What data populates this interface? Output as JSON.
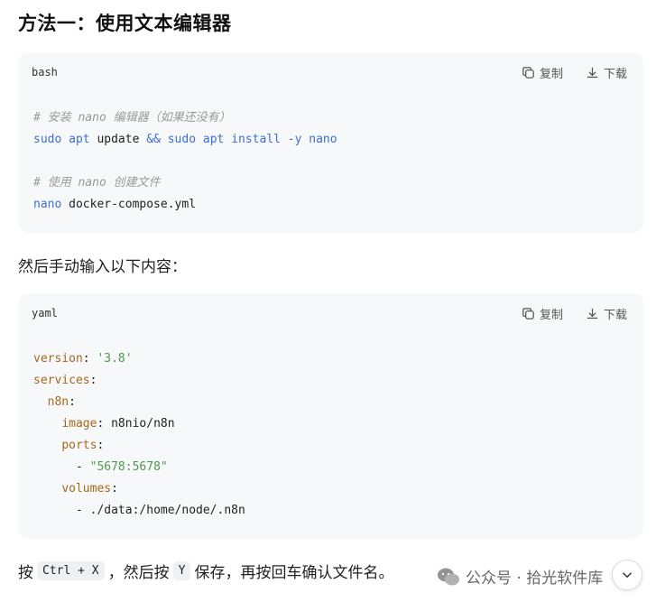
{
  "heading": "方法一：使用文本编辑器",
  "actions": {
    "copy": "复制",
    "download": "下载"
  },
  "block1": {
    "lang": "bash",
    "l1_comment": "# 安装 nano 编辑器（如果还没有）",
    "l2_sudo1": "sudo",
    "l2_apt1": "apt",
    "l2_update": "update",
    "l2_and": "&&",
    "l2_sudo2": "sudo",
    "l2_apt2": "apt",
    "l2_install": "install -y nano",
    "l3_comment": "# 使用 nano 创建文件",
    "l4_nano": "nano",
    "l4_file": "docker-compose.yml"
  },
  "para1": "然后手动输入以下内容：",
  "block2": {
    "lang": "yaml",
    "version_key": "version",
    "version_val": "'3.8'",
    "services_key": "services",
    "n8n_key": "n8n",
    "image_key": "image",
    "image_val": "n8nio/n8n",
    "ports_key": "ports",
    "ports_item": "\"5678:5678\"",
    "volumes_key": "volumes",
    "volumes_item": "./data:/home/node/.n8n"
  },
  "para2": {
    "t1": "按",
    "k1": "Ctrl + X",
    "t2": "，然后按",
    "k2": "Y",
    "t3": "保存，再按回车确认文件名。"
  },
  "watermark": "公众号 · 拾光软件库"
}
